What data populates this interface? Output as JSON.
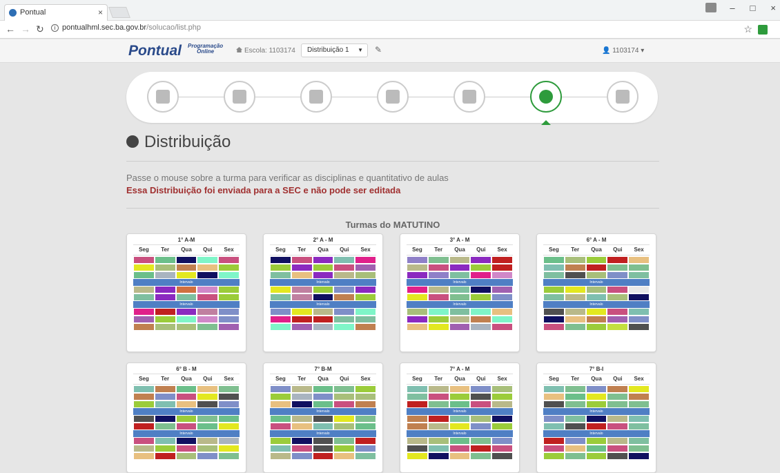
{
  "browser": {
    "tab_title": "Pontual",
    "tab_close": "×",
    "url_host": "pontualhml.sec.ba.gov.br",
    "url_path": "/solucao/list.php",
    "window_buttons": [
      "–",
      "□",
      "×"
    ]
  },
  "navbar": {
    "logo": "Pontual",
    "logo_sub1": "Programação",
    "logo_sub2": "Online",
    "escola_label": "Escola: 1103174",
    "select_value": "Distribuição 1",
    "user": "1103174 ▾"
  },
  "stepper": {
    "steps": [
      {
        "icon": "calendar-icon",
        "active": false
      },
      {
        "icon": "book-icon",
        "active": false
      },
      {
        "icon": "grid-icon",
        "active": false
      },
      {
        "icon": "user-icon",
        "active": false
      },
      {
        "icon": "search-icon",
        "active": false
      },
      {
        "icon": "gear-icon",
        "active": true
      },
      {
        "icon": "file-icon",
        "active": false
      }
    ]
  },
  "page": {
    "title": "Distribuição",
    "info": "Passe o mouse sobre a turma para verificar as disciplinas e quantitativo de aulas",
    "warning": "Essa Distribuição foi enviada para a SEC e não pode ser editada",
    "section_title": "Turmas do MATUTINO",
    "intervalo_label": "Intervalo",
    "days": [
      "Seg",
      "Ter",
      "Qua",
      "Qui",
      "Sex"
    ]
  },
  "colors": {
    "accent_green": "#2e9b3c",
    "warning_red": "#a03030",
    "intervalo_blue": "#4f7fc4"
  },
  "turmas": [
    {
      "name": "1° A-M",
      "rows": [
        [
          "#c9507f",
          "#6bbf8a",
          "#101060",
          "#7ff5c8",
          "#c9507f"
        ],
        [
          "#e3e820",
          "#a8bf7a",
          "#c08050",
          "#e8c080",
          "#9bcc3a"
        ],
        [
          "#6bbf8a",
          "#a9b4c0",
          "#e3e820",
          "#101060",
          "#7ff5c8"
        ],
        "I",
        [
          "#b9b98a",
          "#8b2ac0",
          "#d07040",
          "#d088c8",
          "#9bcc3a"
        ],
        [
          "#7fbfa0",
          "#8b2ac0",
          "#7fbfa0",
          "#c9507f",
          "#9bcc3a"
        ],
        "I",
        [
          "#e0208a",
          "#c02020",
          "#8b2ac0",
          "#c080a0",
          "#7f8fc8"
        ],
        [
          "#a060b0",
          "#9bcc3a",
          "#7ff5c8",
          "#d088c8",
          "#7f8fc8"
        ],
        [
          "#c08050",
          "#a8bf7a",
          "#a8bf7a",
          "#7fbf90",
          "#a060b0"
        ]
      ]
    },
    {
      "name": "2° A - M",
      "rows": [
        [
          "#101060",
          "#c9507f",
          "#8b2ac0",
          "#7fbfb0",
          "#e0208a"
        ],
        [
          "#9bcc3a",
          "#8b2ac0",
          "#9bcc3a",
          "#c9507f",
          "#a060b0"
        ],
        [
          "#7fbfa0",
          "#e8c080",
          "#8b2ac0",
          "#b9b98a",
          "#a8bf7a"
        ],
        "I",
        [
          "#e3e820",
          "#c080a0",
          "#9bcc3a",
          "#7f8fc8",
          "#8b2ac0"
        ],
        [
          "#7fbfa0",
          "#c080a0",
          "#101060",
          "#c08050",
          "#9bcc3a"
        ],
        "I",
        [
          "#7f8fc8",
          "#e3e820",
          "#b9b98a",
          "#7f8fc8",
          "#7ff5c8"
        ],
        [
          "#e0208a",
          "#c02020",
          "#c02020",
          "#7fbfa0",
          "#7fbfa0"
        ],
        [
          "#7ff5c8",
          "#a060b0",
          "#a9b4c0",
          "#7ff5c8",
          "#c08050"
        ]
      ]
    },
    {
      "name": "3° A - M",
      "rows": [
        [
          "#8f80c8",
          "#7fbf90",
          "#b9b98a",
          "#8b2ac0",
          "#c02020"
        ],
        [
          "#b9b98a",
          "#c9507f",
          "#8b2ac0",
          "#9bcc3a",
          "#c02020"
        ],
        [
          "#8b2ac0",
          "#8f80c8",
          "#7fbfa0",
          "#e0208a",
          "#d088c8"
        ],
        "I",
        [
          "#e0208a",
          "#b9b98a",
          "#7fbfa0",
          "#101060",
          "#a060b0"
        ],
        [
          "#e3e820",
          "#c9507f",
          "#7fbf90",
          "#9bcc3a",
          "#7f8fc8"
        ],
        "I",
        [
          "#a8bf7a",
          "#7ff5c8",
          "#7fbfa0",
          "#7ff5c8",
          "#e8c080"
        ],
        [
          "#8b2ac0",
          "#9bcc3a",
          "#b9b98a",
          "#c08050",
          "#7ff5c8"
        ],
        [
          "#e8c080",
          "#e3e820",
          "#a060b0",
          "#a9b4c0",
          "#c9507f"
        ]
      ]
    },
    {
      "name": "6° A - M",
      "rows": [
        [
          "#6bbf8a",
          "#a8bf7a",
          "#9bcc3a",
          "#c02020",
          "#e8c080"
        ],
        [
          "#7fbfb0",
          "#c08050",
          "#c02020",
          "#7fbf90",
          "#7fbf90"
        ],
        [
          "#7fbfa0",
          "#505050",
          "#a8bf7a",
          "#7f8fc8",
          "#7fbfa0"
        ],
        "I",
        [
          "#9bcc3a",
          "#e3e820",
          "#a8bf7a",
          "#c9507f",
          "#e8e8e8"
        ],
        [
          "#7fbfa0",
          "#b9b98a",
          "#7fbfb0",
          "#a8bf7a",
          "#101060"
        ],
        "I",
        [
          "#505050",
          "#b9b98a",
          "#e3e820",
          "#c9507f",
          "#7fbfb0"
        ],
        [
          "#101060",
          "#e8c080",
          "#c08050",
          "#a060b0",
          "#7f8fc8"
        ],
        [
          "#c9507f",
          "#7fbf90",
          "#9bcc3a",
          "#c3e040",
          "#505050"
        ]
      ]
    },
    {
      "name": "6° B - M",
      "rows": [
        [
          "#7fbfb0",
          "#c08050",
          "#6bbf8a",
          "#e8c080",
          "#7fbf90"
        ],
        [
          "#c08050",
          "#7f8fc8",
          "#c9507f",
          "#e3e820",
          "#505050"
        ],
        [
          "#9bcc3a",
          "#7fbfb0",
          "#e8c080",
          "#505050",
          "#7f8fc8"
        ],
        "I",
        [
          "#505050",
          "#101060",
          "#9bcc3a",
          "#7fbf90",
          "#6bbf8a"
        ],
        [
          "#c02020",
          "#7fbf90",
          "#c9507f",
          "#6bbf8a",
          "#e3e820"
        ],
        "I",
        [
          "#c9507f",
          "#7fbfb0",
          "#101060",
          "#b9b98a",
          "#a9b4c0"
        ],
        [
          "#b9b98a",
          "#9bcc3a",
          "#c9507f",
          "#a8bf7a",
          "#e3e820"
        ],
        [
          "#e8c080",
          "#c02020",
          "#a8bf7a",
          "#7f8fc8",
          "#7fbf90"
        ]
      ]
    },
    {
      "name": "7° B-M",
      "rows": [
        [
          "#7f8fc8",
          "#b9b98a",
          "#6bbf8a",
          "#7fbf90",
          "#9bcc3a"
        ],
        [
          "#9bcc3a",
          "#a9b4c0",
          "#7f8fc8",
          "#a8bf7a",
          "#a8bf7a"
        ],
        [
          "#e8c080",
          "#101060",
          "#6bbf8a",
          "#c9507f",
          "#c08050"
        ],
        "I",
        [
          "#6bbf8a",
          "#b9b98a",
          "#505050",
          "#e3e820",
          "#7fbf90"
        ],
        [
          "#c9507f",
          "#e8c080",
          "#7fbfb0",
          "#a8bf7a",
          "#6bbf8a"
        ],
        "I",
        [
          "#9bcc3a",
          "#101060",
          "#505050",
          "#7fbf90",
          "#c02020"
        ],
        [
          "#7fbfb0",
          "#c9507f",
          "#505050",
          "#9bcc3a",
          "#7f8fc8"
        ],
        [
          "#b9b98a",
          "#7f8fc8",
          "#c02020",
          "#e8c080",
          "#7fbfa0"
        ]
      ]
    },
    {
      "name": "7° A - M",
      "rows": [
        [
          "#7fbfb0",
          "#b9b98a",
          "#e8c080",
          "#7f8fc8",
          "#a8bf7a"
        ],
        [
          "#7fbfa0",
          "#c9507f",
          "#9bcc3a",
          "#505050",
          "#9bcc3a"
        ],
        [
          "#c02020",
          "#7fbf90",
          "#6bbf8a",
          "#c9507f",
          "#b9b98a"
        ],
        "I",
        [
          "#c08050",
          "#c02020",
          "#7fbfa0",
          "#a8bf7a",
          "#101060"
        ],
        [
          "#c08050",
          "#b9b98a",
          "#e3e820",
          "#7f8fc8",
          "#9bcc3a"
        ],
        "I",
        [
          "#b9b98a",
          "#a8bf7a",
          "#6bbf8a",
          "#7fbf90",
          "#7f8fc8"
        ],
        [
          "#505050",
          "#7fbfb0",
          "#c9507f",
          "#c02020",
          "#c9507f"
        ],
        [
          "#e3e820",
          "#101060",
          "#e8c080",
          "#7fbf90",
          "#505050"
        ]
      ]
    },
    {
      "name": "7° B-I",
      "rows": [
        [
          "#7fbfb0",
          "#7fbf90",
          "#7f8fc8",
          "#c08050",
          "#e3e820"
        ],
        [
          "#e8c080",
          "#6bbf8a",
          "#e3e820",
          "#7fbf90",
          "#c08050"
        ],
        [
          "#505050",
          "#7fbf90",
          "#9bcc3a",
          "#7fbf90",
          "#7fbf90"
        ],
        "I",
        [
          "#7f8fc8",
          "#7fbfa0",
          "#101060",
          "#b9b98a",
          "#7fbfb0"
        ],
        [
          "#7fbfb0",
          "#505050",
          "#c02020",
          "#c9507f",
          "#7fbfa0"
        ],
        "I",
        [
          "#c02020",
          "#7f8fc8",
          "#9bcc3a",
          "#b9b98a",
          "#7fbfa0"
        ],
        [
          "#c9507f",
          "#e8c080",
          "#6bbf8a",
          "#c9507f",
          "#7fbf90"
        ],
        [
          "#9bcc3a",
          "#7fbf90",
          "#9bcc3a",
          "#505050",
          "#101060"
        ]
      ]
    }
  ]
}
